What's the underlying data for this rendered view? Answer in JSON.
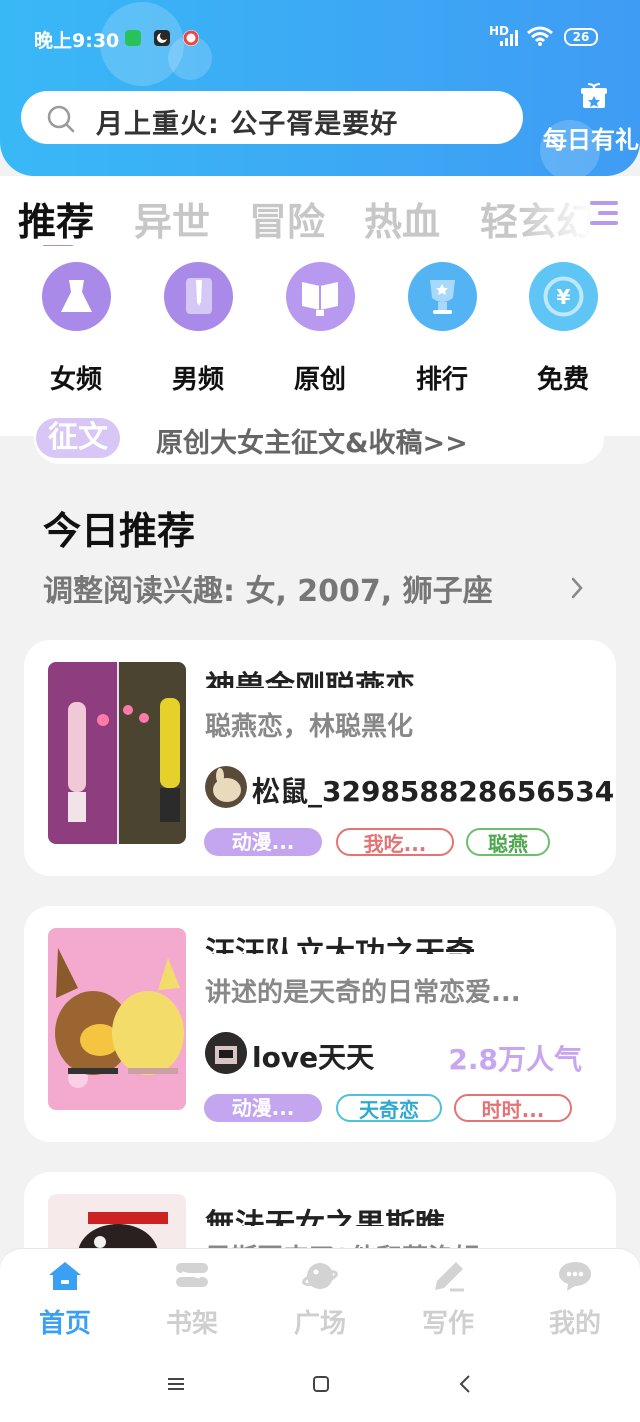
{
  "status_bar": {
    "time": "晚上9:30",
    "signal_label": "HD",
    "battery": "26"
  },
  "search": {
    "placeholder": "月上重火: 公子胥是要好"
  },
  "daily_gift": {
    "label": "每日有礼"
  },
  "tabs": [
    {
      "label": "推荐",
      "active": true
    },
    {
      "label": "异世",
      "active": false
    },
    {
      "label": "冒险",
      "active": false
    },
    {
      "label": "热血",
      "active": false
    },
    {
      "label": "轻玄幻",
      "active": false
    }
  ],
  "categories": [
    {
      "label": "女频",
      "icon": "dress-icon"
    },
    {
      "label": "男频",
      "icon": "shirt-icon"
    },
    {
      "label": "原创",
      "icon": "book-icon"
    },
    {
      "label": "排行",
      "icon": "trophy-icon"
    },
    {
      "label": "免费",
      "icon": "yuan-coin-icon"
    }
  ],
  "banner": {
    "badge": "征文",
    "text": "原创大女主征文&收稿>>"
  },
  "section": {
    "title": "今日推荐",
    "interest": "调整阅读兴趣: 女, 2007, 狮子座"
  },
  "books": [
    {
      "title": "神兽金刚聪燕恋",
      "desc": "聪燕恋，林聪黑化",
      "author": "松鼠_329858828656534...",
      "popularity": "",
      "tags": [
        {
          "label": "动漫...",
          "style": "filled"
        },
        {
          "label": "我吃...",
          "style": "red"
        },
        {
          "label": "聪燕",
          "style": "green"
        }
      ]
    },
    {
      "title": "汪汪队立大功之天奇",
      "desc": "讲述的是天奇的日常恋爱...",
      "author": "love天天",
      "popularity": "2.8万人气",
      "tags": [
        {
          "label": "动漫...",
          "style": "filled"
        },
        {
          "label": "天奇恋",
          "style": "cyan"
        },
        {
          "label": "时时...",
          "style": "red"
        }
      ]
    },
    {
      "title": "無法无女之果斯瞧",
      "desc": "果斯回来了?他和莱洛娟",
      "author": "",
      "popularity": "",
      "tags": []
    }
  ],
  "bottom_nav": [
    {
      "label": "首页",
      "icon": "home-icon",
      "active": true
    },
    {
      "label": "书架",
      "icon": "bookshelf-icon",
      "active": false
    },
    {
      "label": "广场",
      "icon": "planet-icon",
      "active": false
    },
    {
      "label": "写作",
      "icon": "pen-icon",
      "active": false
    },
    {
      "label": "我的",
      "icon": "chat-bubble-icon",
      "active": false
    }
  ],
  "colors": {
    "header_start": "#39b8f6",
    "header_end": "#3f9cf4",
    "accent": "#3aa0f4",
    "purple": "#b79af0"
  }
}
